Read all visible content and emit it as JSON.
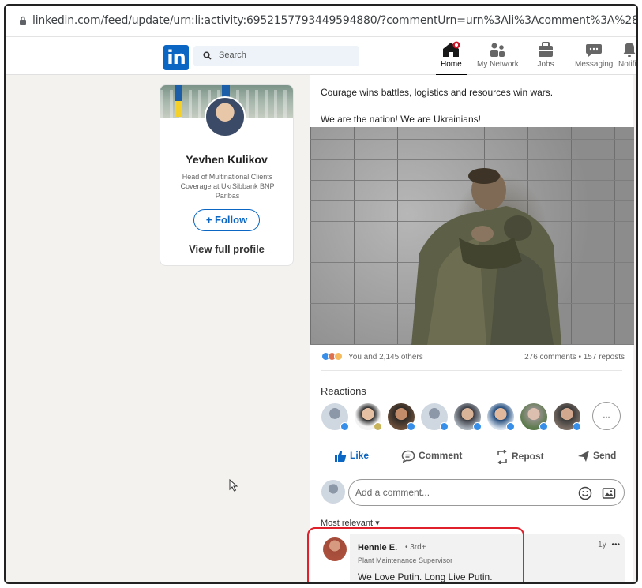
{
  "browser": {
    "url": "linkedin.com/feed/update/urn:li:activity:6952157793449594880/?commentUrn=urn%3Ali%3Acomment%3A%28activity%3A69521577"
  },
  "nav": {
    "logo": "in",
    "search_placeholder": "Search",
    "items": [
      {
        "label": "Home",
        "icon": "home-icon"
      },
      {
        "label": "My Network",
        "icon": "network-icon"
      },
      {
        "label": "Jobs",
        "icon": "jobs-icon"
      },
      {
        "label": "Messaging",
        "icon": "messaging-icon"
      },
      {
        "label": "Notific",
        "icon": "bell-icon"
      }
    ],
    "accent": "#0a66c2"
  },
  "profile": {
    "name": "Yevhen Kulikov",
    "title": "Head of Multinational Clients Coverage at UkrSibbank BNP Paribas",
    "follow_label": "+ Follow",
    "view_profile_label": "View full profile"
  },
  "post": {
    "line1": "Courage wins battles, logistics and resources win wars.",
    "line2": "We are the nation! We are Ukrainians!",
    "reactions_summary": "You and 2,145 others",
    "engagement": "276 comments • 157 reposts",
    "reactions_title": "Reactions",
    "more_reactions_label": "...",
    "actions": {
      "like": "Like",
      "comment": "Comment",
      "repost": "Repost",
      "send": "Send"
    },
    "comment_placeholder": "Add a comment...",
    "sort_label": "Most relevant"
  },
  "comment": {
    "author": "Hennie E.",
    "degree": "• 3rd+",
    "role": "Plant Maintenance Supervisor",
    "text": "We Love Putin. Long Live Putin.",
    "time": "1y",
    "menu": "•••"
  },
  "highlight_color": "#e0202a"
}
